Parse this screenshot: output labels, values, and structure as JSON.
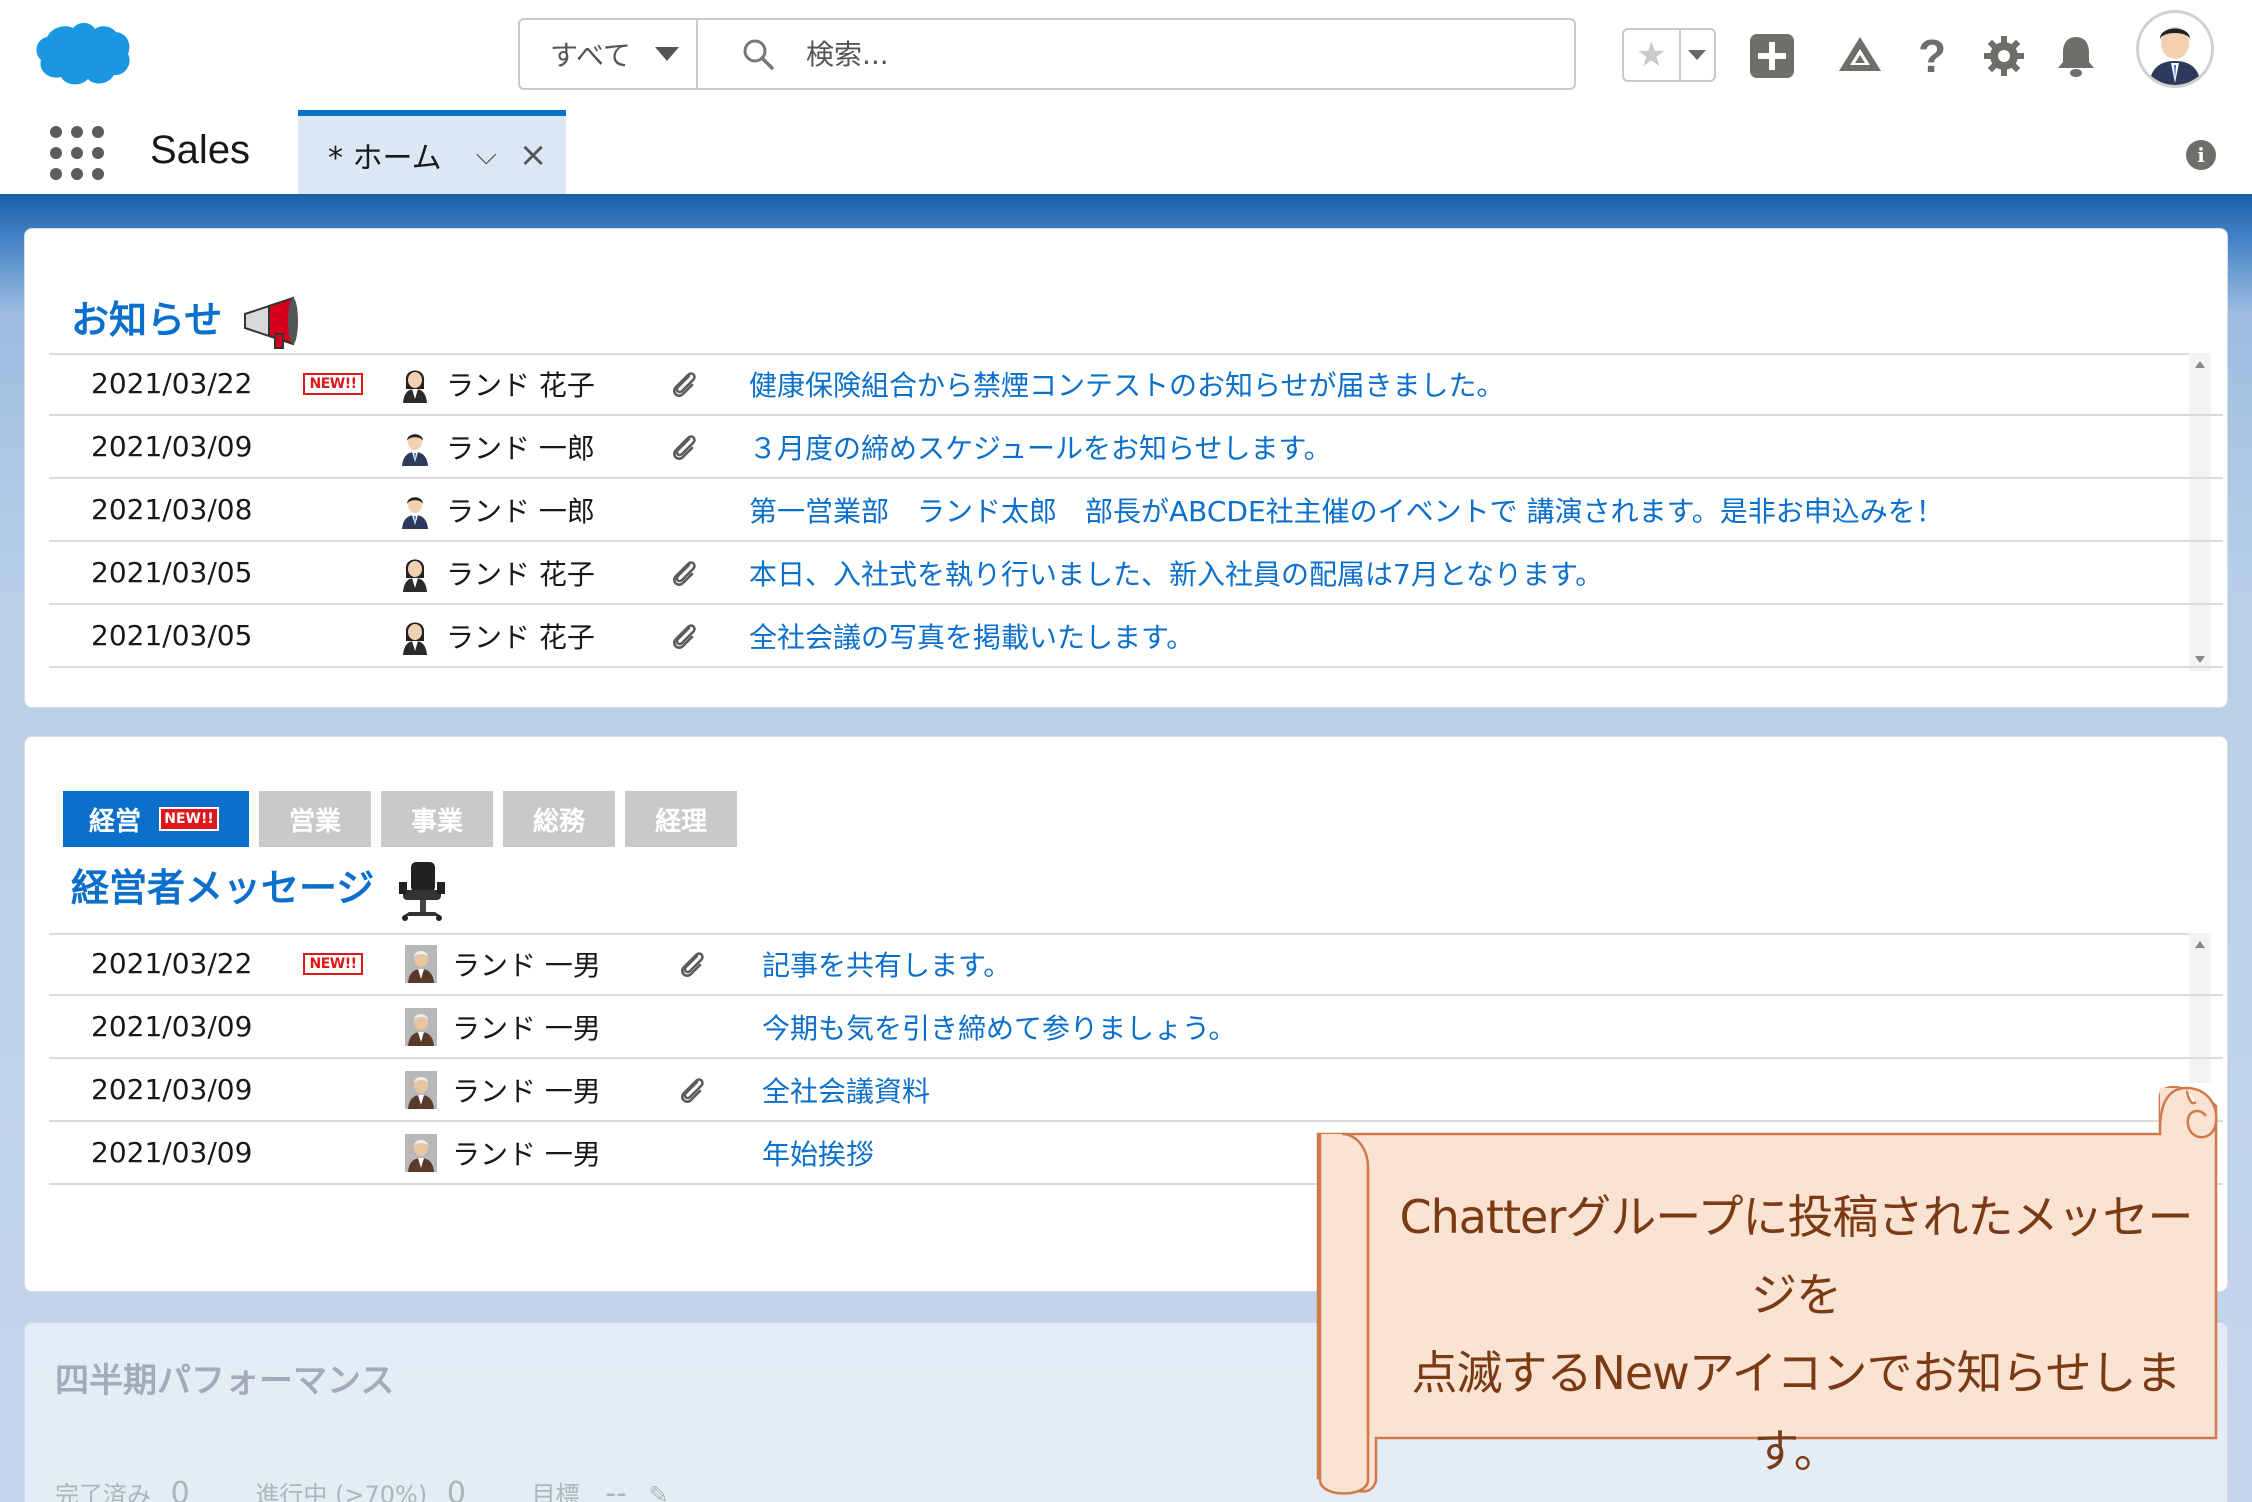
{
  "header": {
    "search_scope": "すべて",
    "search_placeholder": "検索...",
    "icons": [
      "salesforce-cloud-logo",
      "favorite-star-icon",
      "add-icon",
      "trailhead-icon",
      "help-icon",
      "setup-gear-icon",
      "notification-bell-icon",
      "user-avatar"
    ]
  },
  "nav": {
    "app_name": "Sales",
    "tab_label": "* ホーム"
  },
  "announcements": {
    "title": "お知らせ",
    "rows": [
      {
        "date": "2021/03/22",
        "is_new": true,
        "new_label": "NEW!!",
        "author": "ランド 花子",
        "gender": "female",
        "attachment": true,
        "subject": "健康保険組合から禁煙コンテストのお知らせが届きました。"
      },
      {
        "date": "2021/03/09",
        "is_new": false,
        "new_label": "",
        "author": "ランド 一郎",
        "gender": "male",
        "attachment": true,
        "subject": "３月度の締めスケジュールをお知らせします。"
      },
      {
        "date": "2021/03/08",
        "is_new": false,
        "new_label": "",
        "author": "ランド 一郎",
        "gender": "male",
        "attachment": false,
        "subject": "第一営業部　ランド太郎　部長がABCDE社主催のイベントで 講演されます。是非お申込みを！"
      },
      {
        "date": "2021/03/05",
        "is_new": false,
        "new_label": "",
        "author": "ランド 花子",
        "gender": "female",
        "attachment": true,
        "subject": "本日、入社式を執り行いました、新入社員の配属は7月となります。"
      },
      {
        "date": "2021/03/05",
        "is_new": false,
        "new_label": "",
        "author": "ランド 花子",
        "gender": "female",
        "attachment": true,
        "subject": "全社会議の写真を掲載いたします。"
      }
    ]
  },
  "dept": {
    "tabs": [
      {
        "label": "経営",
        "active": true,
        "new_label": "NEW!!"
      },
      {
        "label": "営業",
        "active": false,
        "new_label": ""
      },
      {
        "label": "事業",
        "active": false,
        "new_label": ""
      },
      {
        "label": "総務",
        "active": false,
        "new_label": ""
      },
      {
        "label": "経理",
        "active": false,
        "new_label": ""
      }
    ],
    "title": "経営者メッセージ",
    "rows": [
      {
        "date": "2021/03/22",
        "is_new": true,
        "new_label": "NEW!!",
        "author": "ランド 一男",
        "attachment": true,
        "subject": "記事を共有します。"
      },
      {
        "date": "2021/03/09",
        "is_new": false,
        "new_label": "",
        "author": "ランド 一男",
        "attachment": false,
        "subject": "今期も気を引き締めて参りましょう。"
      },
      {
        "date": "2021/03/09",
        "is_new": false,
        "new_label": "",
        "author": "ランド 一男",
        "attachment": true,
        "subject": "全社会議資料"
      },
      {
        "date": "2021/03/09",
        "is_new": false,
        "new_label": "",
        "author": "ランド 一男",
        "attachment": false,
        "subject": "年始挨拶"
      }
    ]
  },
  "performance": {
    "title": "四半期パフォーマンス",
    "completed_label": "完了済み",
    "completed_value": "0",
    "in_progress_label": "進行中 (>70%)",
    "in_progress_value": "0",
    "goal_label": "目標",
    "goal_value": "--"
  },
  "callout": {
    "line1": "Chatterグループに投稿されたメッセージを",
    "line2": "点滅するNewアイコンでお知らせします。"
  },
  "colors": {
    "brand_blue": "#0b6fcc",
    "new_red": "#e0161b",
    "callout_fill": "#fbe3d4",
    "callout_border": "#d07a4a"
  }
}
